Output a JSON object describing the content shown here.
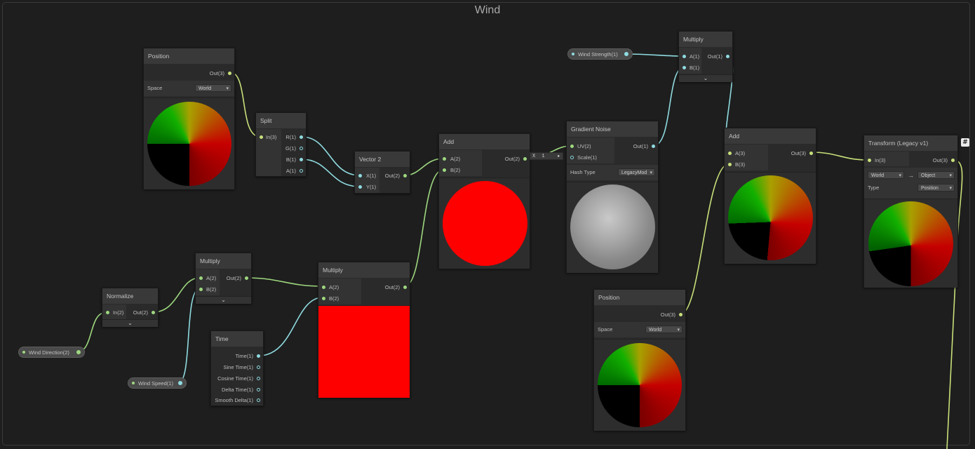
{
  "group": {
    "title": "Wind"
  },
  "colors": {
    "background": "#1e1e1e",
    "node_body": "#2a2a2a",
    "node_header": "#393939",
    "wire_vector": "#8fdbe0",
    "wire_vec3": "#c8e07a",
    "wire_vec2": "#9ed87f",
    "red_preview": "#ff0000"
  },
  "properties": {
    "wind_strength": {
      "label": "Wind Strength(1)"
    },
    "wind_direction": {
      "label": "Wind Direction(2)"
    },
    "wind_speed": {
      "label": "Wind Speed(1)"
    }
  },
  "nodes": {
    "position1": {
      "title": "Position",
      "out": "Out(3)",
      "space_label": "Space",
      "space_value": "World"
    },
    "split": {
      "title": "Split",
      "in": "In(3)",
      "outs": [
        "R(1)",
        "G(1)",
        "B(1)",
        "A(1)"
      ]
    },
    "vector2": {
      "title": "Vector 2",
      "x": "X(1)",
      "y": "Y(1)",
      "out": "Out(2)"
    },
    "add1": {
      "title": "Add",
      "a": "A(2)",
      "b": "B(2)",
      "out": "Out(2)"
    },
    "gradient_noise": {
      "title": "Gradient Noise",
      "uv": "UV(2)",
      "scale": "Scale(1)",
      "out": "Out(1)",
      "hash_label": "Hash Type",
      "hash_value": "LegacyMod",
      "uv_field_x": "X",
      "uv_field_value": "1"
    },
    "multiply_top": {
      "title": "Multiply",
      "a": "A(1)",
      "b": "B(1)",
      "out": "Out(1)"
    },
    "add2": {
      "title": "Add",
      "a": "A(3)",
      "b": "B(3)",
      "out": "Out(3)"
    },
    "transform": {
      "title": "Transform (Legacy v1)",
      "in": "In(3)",
      "out": "Out(3)",
      "from": "World",
      "arrow": "→",
      "to": "Object",
      "type_label": "Type",
      "type_value": "Position"
    },
    "normalize": {
      "title": "Normalize",
      "in": "In(2)",
      "out": "Out(2)"
    },
    "multiply_left": {
      "title": "Multiply",
      "a": "A(2)",
      "b": "B(2)",
      "out": "Out(2)"
    },
    "multiply_mid": {
      "title": "Multiply",
      "a": "A(2)",
      "b": "B(2)",
      "out": "Out(2)"
    },
    "time": {
      "title": "Time",
      "outs": [
        "Time(1)",
        "Sine Time(1)",
        "Cosine Time(1)",
        "Delta Time(1)",
        "Smooth Delta(1)"
      ]
    },
    "position2": {
      "title": "Position",
      "out": "Out(3)",
      "space_label": "Space",
      "space_value": "World"
    }
  },
  "icons": {
    "chevron": "chevron-down-icon",
    "hash": "#"
  }
}
